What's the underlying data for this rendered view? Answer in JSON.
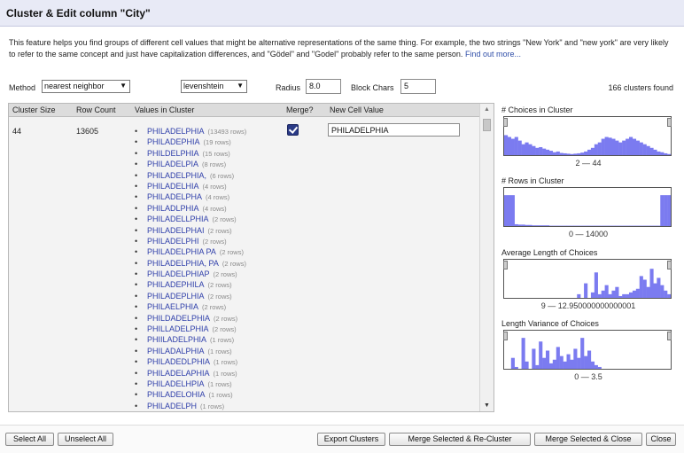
{
  "dialog": {
    "title": "Cluster & Edit column \"City\""
  },
  "description": {
    "text": "This feature helps you find groups of different cell values that might be alternative representations of the same thing. For example, the two strings \"New York\" and \"new york\" are very likely to refer to the same concept and just have capitalization differences, and \"Gödel\" and \"Godel\" probably refer to the same person.",
    "link": "Find out more..."
  },
  "controls": {
    "method_label": "Method",
    "method_value": "nearest neighbor",
    "function_value": "levenshtein",
    "radius_label": "Radius",
    "radius_value": "8.0",
    "block_label": "Block Chars",
    "block_value": "5",
    "clusters_found": "166 clusters found"
  },
  "table": {
    "headers": {
      "size": "Cluster Size",
      "count": "Row Count",
      "values": "Values in Cluster",
      "merge": "Merge?",
      "new": "New Cell Value"
    },
    "row": {
      "size": "44",
      "count": "13605",
      "new_value": "PHILADELPHIA",
      "merge": true,
      "values": [
        {
          "value": "PHILADELPHIA",
          "rows": "(13493 rows)"
        },
        {
          "value": "PHILADEPHIA",
          "rows": "(19 rows)"
        },
        {
          "value": "PHILDELPHIA",
          "rows": "(15 rows)"
        },
        {
          "value": "PHILADELPIA",
          "rows": "(8 rows)"
        },
        {
          "value": "PHILADELPHIA,",
          "rows": "(6 rows)"
        },
        {
          "value": "PHILADELHIA",
          "rows": "(4 rows)"
        },
        {
          "value": "PHILADELPHA",
          "rows": "(4 rows)"
        },
        {
          "value": "PHILADLPHIA",
          "rows": "(4 rows)"
        },
        {
          "value": "PHILADELLPHIA",
          "rows": "(2 rows)"
        },
        {
          "value": "PHILADELPHAI",
          "rows": "(2 rows)"
        },
        {
          "value": "PHILADELPHI",
          "rows": "(2 rows)"
        },
        {
          "value": "PHILADELPHIA PA",
          "rows": "(2 rows)"
        },
        {
          "value": "PHILADELPHIA, PA",
          "rows": "(2 rows)"
        },
        {
          "value": "PHILADELPHIAP",
          "rows": "(2 rows)"
        },
        {
          "value": "PHILADEPHILA",
          "rows": "(2 rows)"
        },
        {
          "value": "PHILADEPLHIA",
          "rows": "(2 rows)"
        },
        {
          "value": "PHILAELPHIA",
          "rows": "(2 rows)"
        },
        {
          "value": "PHILDADELPHIA",
          "rows": "(2 rows)"
        },
        {
          "value": "PHILLADELPHIA",
          "rows": "(2 rows)"
        },
        {
          "value": "PHIILADELPHIA",
          "rows": "(1 rows)"
        },
        {
          "value": "PHILADALPHIA",
          "rows": "(1 rows)"
        },
        {
          "value": "PHILADEDLPHIA",
          "rows": "(1 rows)"
        },
        {
          "value": "PHILADELAPHIA",
          "rows": "(1 rows)"
        },
        {
          "value": "PHILADELHPIA",
          "rows": "(1 rows)"
        },
        {
          "value": "PHILADELOHIA",
          "rows": "(1 rows)"
        },
        {
          "value": "PHILADELPH",
          "rows": "(1 rows)"
        }
      ]
    }
  },
  "facets": [
    {
      "title": "# Choices in Cluster",
      "range": "2 — 44",
      "color": "#7b7bf0",
      "bars": [
        0.55,
        0.5,
        0.45,
        0.5,
        0.4,
        0.3,
        0.35,
        0.3,
        0.25,
        0.2,
        0.22,
        0.18,
        0.15,
        0.12,
        0.08,
        0.1,
        0.06,
        0.05,
        0.04,
        0.03,
        0.04,
        0.05,
        0.07,
        0.1,
        0.15,
        0.2,
        0.3,
        0.35,
        0.45,
        0.5,
        0.48,
        0.45,
        0.4,
        0.35,
        0.4,
        0.45,
        0.5,
        0.45,
        0.4,
        0.35,
        0.3,
        0.25,
        0.2,
        0.15,
        0.1,
        0.08,
        0.05,
        0.03
      ]
    },
    {
      "title": "# Rows in Cluster",
      "range": "0 — 14000",
      "color": "#7b7bf0",
      "bars": [
        0.85,
        0.85,
        0.85,
        0.05,
        0.04,
        0.04,
        0.03,
        0.03,
        0.02,
        0.02,
        0.02,
        0.02,
        0.02,
        0.01,
        0.01,
        0.01,
        0.01,
        0.01,
        0.01,
        0.01,
        0.01,
        0.01,
        0.01,
        0.01,
        0.01,
        0.01,
        0.01,
        0.01,
        0.01,
        0.01,
        0.01,
        0.01,
        0.01,
        0.01,
        0.01,
        0.01,
        0.01,
        0.01,
        0.01,
        0.01,
        0.01,
        0.01,
        0.01,
        0.01,
        0.01,
        0.85,
        0.85,
        0.85
      ]
    },
    {
      "title": "Average Length of Choices",
      "range": "9 — 12.950000000000001",
      "color": "#7b7bf0",
      "bars": [
        0,
        0,
        0,
        0,
        0,
        0,
        0,
        0,
        0,
        0,
        0,
        0,
        0,
        0,
        0,
        0,
        0,
        0,
        0,
        0,
        0,
        0.1,
        0,
        0.4,
        0,
        0.15,
        0.7,
        0.1,
        0.2,
        0.35,
        0.1,
        0.2,
        0.3,
        0.05,
        0.1,
        0.1,
        0.15,
        0.2,
        0.25,
        0.6,
        0.5,
        0.3,
        0.8,
        0.4,
        0.55,
        0.35,
        0.2,
        0.1
      ]
    },
    {
      "title": "Length Variance of Choices",
      "range": "0 — 3.5",
      "color": "#7b7bf0",
      "bars": [
        0,
        0,
        0.3,
        0.05,
        0,
        0.85,
        0.2,
        0,
        0.55,
        0.1,
        0.75,
        0.3,
        0.5,
        0.15,
        0.25,
        0.6,
        0.35,
        0.2,
        0.4,
        0.25,
        0.55,
        0.3,
        0.85,
        0.35,
        0.5,
        0.2,
        0.1,
        0.05,
        0,
        0,
        0,
        0,
        0,
        0,
        0,
        0,
        0,
        0,
        0,
        0,
        0,
        0,
        0,
        0,
        0,
        0,
        0,
        0
      ]
    }
  ],
  "buttons": {
    "select_all": "Select All",
    "unselect_all": "Unselect All",
    "export": "Export Clusters",
    "merge_recluster": "Merge Selected & Re-Cluster",
    "merge_close": "Merge Selected & Close",
    "close": "Close"
  }
}
